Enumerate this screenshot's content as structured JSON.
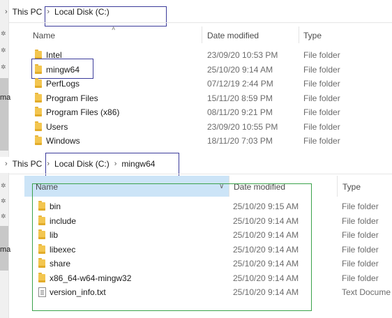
{
  "top": {
    "breadcrumb": [
      "This PC",
      "Local Disk (C:)"
    ],
    "columns": {
      "name": "Name",
      "date": "Date modified",
      "type": "Type"
    },
    "rows": [
      {
        "name": "Intel",
        "date": "23/09/20 10:53 PM",
        "type": "File folder",
        "icon": "folder-icon"
      },
      {
        "name": "mingw64",
        "date": "25/10/20 9:14 AM",
        "type": "File folder",
        "icon": "folder-icon"
      },
      {
        "name": "PerfLogs",
        "date": "07/12/19 2:44 PM",
        "type": "File folder",
        "icon": "folder-icon"
      },
      {
        "name": "Program Files",
        "date": "15/11/20 8:59 PM",
        "type": "File folder",
        "icon": "folder-icon"
      },
      {
        "name": "Program Files (x86)",
        "date": "08/11/20 9:21 PM",
        "type": "File folder",
        "icon": "folder-icon"
      },
      {
        "name": "Users",
        "date": "23/09/20 10:55 PM",
        "type": "File folder",
        "icon": "folder-icon"
      },
      {
        "name": "Windows",
        "date": "18/11/20 7:03 PM",
        "type": "File folder",
        "icon": "folder-icon"
      }
    ]
  },
  "bottom": {
    "breadcrumb": [
      "This PC",
      "Local Disk (C:)",
      "mingw64"
    ],
    "columns": {
      "name": "Name",
      "date": "Date modified",
      "type": "Type"
    },
    "rows": [
      {
        "name": "bin",
        "date": "25/10/20 9:15 AM",
        "type": "File folder",
        "icon": "folder-icon"
      },
      {
        "name": "include",
        "date": "25/10/20 9:14 AM",
        "type": "File folder",
        "icon": "folder-icon"
      },
      {
        "name": "lib",
        "date": "25/10/20 9:14 AM",
        "type": "File folder",
        "icon": "folder-icon"
      },
      {
        "name": "libexec",
        "date": "25/10/20 9:14 AM",
        "type": "File folder",
        "icon": "folder-icon"
      },
      {
        "name": "share",
        "date": "25/10/20 9:14 AM",
        "type": "File folder",
        "icon": "folder-icon"
      },
      {
        "name": "x86_64-w64-mingw32",
        "date": "25/10/20 9:14 AM",
        "type": "File folder",
        "icon": "folder-icon"
      },
      {
        "name": "version_info.txt",
        "date": "25/10/20 9:14 AM",
        "type": "Text Docume",
        "icon": "text-file-icon"
      }
    ]
  },
  "left_fragments": {
    "top": "ma",
    "bottom": "ma"
  },
  "annotations": {
    "box_color": "#3b3b9a",
    "green_box_color": "#3aa24a"
  },
  "colors": {
    "selected_header": "#cce4f7",
    "folder": "#f3c650"
  }
}
